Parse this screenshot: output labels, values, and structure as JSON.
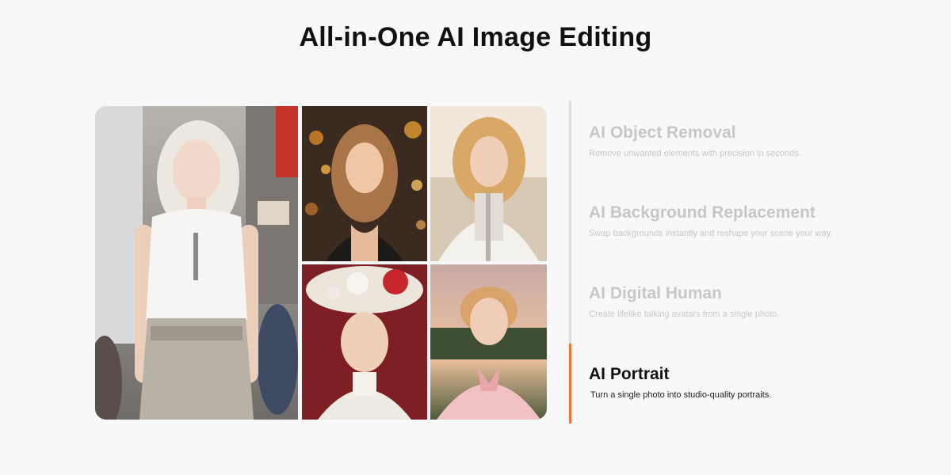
{
  "page": {
    "title": "All-in-One AI Image Editing"
  },
  "gallery": {
    "images": [
      {
        "name": "street-fashion-portrait"
      },
      {
        "name": "bokeh-lights-portrait"
      },
      {
        "name": "white-jacket-portrait"
      },
      {
        "name": "flower-hat-portrait"
      },
      {
        "name": "sunset-vintage-portrait"
      }
    ]
  },
  "features": {
    "active_index": 3,
    "accent_color": "#e8743b",
    "items": [
      {
        "title": "AI Object Removal",
        "description": "Remove unwanted elements with precision in seconds."
      },
      {
        "title": "AI Background Replacement",
        "description": "Swap backgrounds instantly and reshape your scene your way."
      },
      {
        "title": "AI Digital Human",
        "description": "Create lifelike talking avatars from a single photo."
      },
      {
        "title": "AI Portrait",
        "description": "Turn a single photo into studio-quality portraits."
      }
    ]
  }
}
